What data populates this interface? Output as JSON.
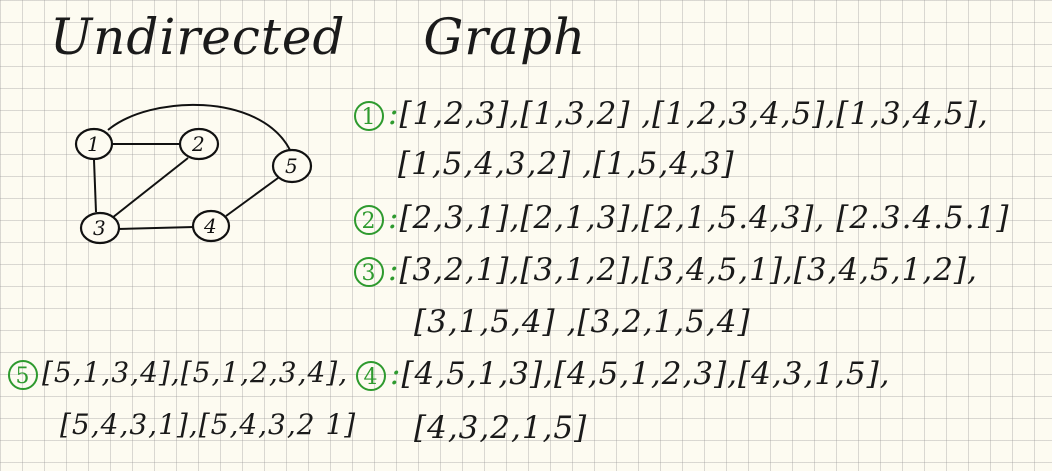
{
  "title": {
    "word1": "Undirected",
    "word2": "Graph"
  },
  "graph": {
    "nodes": [
      "1",
      "2",
      "3",
      "4",
      "5"
    ]
  },
  "lists": {
    "v1": {
      "marker": "1",
      "line1": "[1,2,3],[1,3,2] ,[1,2,3,4,5],[1,3,4,5],",
      "line2": "[1,5,4,3,2] ,[1,5,4,3]"
    },
    "v2": {
      "marker": "2",
      "line1": "[2,3,1],[2,1,3],[2,1,5.4,3], [2.3.4.5.1]"
    },
    "v3": {
      "marker": "3",
      "line1": "[3,2,1],[3,1,2],[3,4,5,1],[3,4,5,1,2],",
      "line2": "[3,1,5,4] ,[3,2,1,5,4]"
    },
    "v4": {
      "marker": "4",
      "line1": "[4,5,1,3],[4,5,1,2,3],[4,3,1,5],",
      "line2": "[4,3,2,1,5]"
    },
    "v5": {
      "marker": "5",
      "line1": "[5,1,3,4],[5,1,2,3,4],",
      "line2": "[5,4,3,1],[5,4,3,2 1]"
    }
  },
  "colors": {
    "marker": "#2e9a2e",
    "ink": "#1a1a1a",
    "paper": "#fdfbf1"
  }
}
